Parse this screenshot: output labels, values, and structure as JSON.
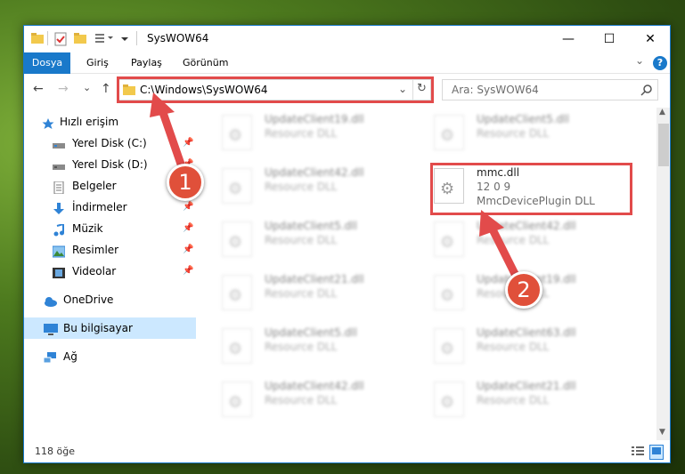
{
  "window": {
    "title": "SysWOW64",
    "min": "—",
    "max": "☐",
    "close": "✕"
  },
  "ribbon": {
    "tabs": [
      "Dosya",
      "Giriş",
      "Paylaş",
      "Görünüm"
    ],
    "collapse": "⌄",
    "help": "?"
  },
  "nav": {
    "back": "←",
    "forward": "→",
    "recent": "⌄",
    "up": "↑",
    "address": "C:\\Windows\\SysWOW64",
    "dropdown": "⌄",
    "refresh": "↻",
    "search_placeholder": "Ara: SysWOW64"
  },
  "sidebar": {
    "items": [
      {
        "label": "Hızlı erişim",
        "pinned": false
      },
      {
        "label": "Yerel Disk (C:)",
        "pinned": true
      },
      {
        "label": "Yerel Disk (D:)",
        "pinned": true
      },
      {
        "label": "Belgeler",
        "pinned": true
      },
      {
        "label": "İndirmeler",
        "pinned": true
      },
      {
        "label": "Müzik",
        "pinned": true
      },
      {
        "label": "Resimler",
        "pinned": true
      },
      {
        "label": "Videolar",
        "pinned": true
      },
      {
        "label": "OneDrive",
        "pinned": false
      },
      {
        "label": "Bu bilgisayar",
        "pinned": false
      },
      {
        "label": "Ağ",
        "pinned": false
      }
    ]
  },
  "files": {
    "left": [
      {
        "name": "UpdateClient19.dll",
        "desc": "Resource DLL"
      },
      {
        "name": "UpdateClient42.dll",
        "desc": "Resource DLL"
      },
      {
        "name": "UpdateClient5.dll",
        "desc": "Resource DLL"
      },
      {
        "name": "UpdateClient21.dll",
        "desc": "Resource DLL"
      },
      {
        "name": "UpdateClient5.dll",
        "desc": "Resource DLL"
      },
      {
        "name": "UpdateClient42.dll",
        "desc": "Resource DLL"
      }
    ],
    "right": [
      {
        "name": "UpdateClient5.dll",
        "desc": "Resource DLL"
      },
      {
        "name": "mmc.dll",
        "version": "12 0 9",
        "desc": "MmcDevicePlugin DLL"
      },
      {
        "name": "UpdateClient42.dll",
        "desc": "Resource DLL"
      },
      {
        "name": "UpdateClient19.dll",
        "desc": "Resource DLL"
      },
      {
        "name": "UpdateClient63.dll",
        "desc": "Resource DLL"
      },
      {
        "name": "UpdateClient21.dll",
        "desc": "Resource DLL"
      }
    ]
  },
  "status": {
    "count": "118 öğe"
  },
  "annotations": {
    "step1": "1",
    "step2": "2"
  }
}
